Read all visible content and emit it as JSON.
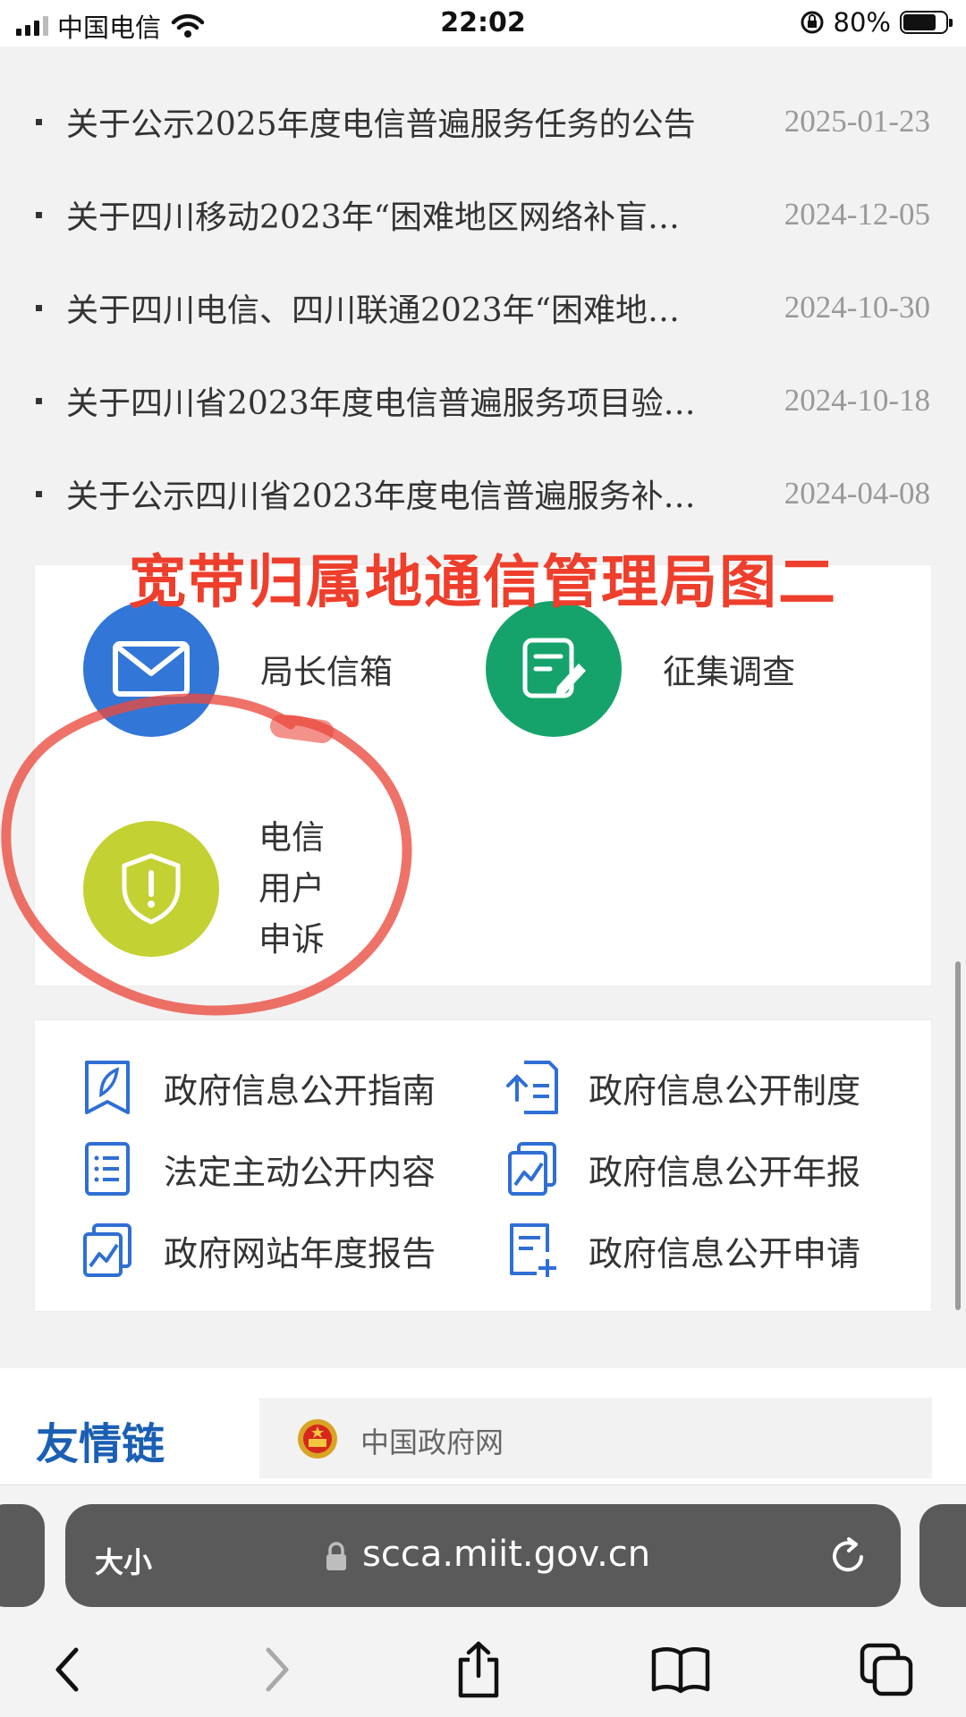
{
  "status_bar": {
    "carrier": "中国电信",
    "time": "22:02",
    "battery": "80%"
  },
  "news": [
    {
      "title": "关于公示2025年度电信普遍服务任务的公告",
      "date": "2025-01-23"
    },
    {
      "title": "关于四川移动2023年“困难地区网络补盲…",
      "date": "2024-12-05"
    },
    {
      "title": "关于四川电信、四川联通2023年“困难地…",
      "date": "2024-10-30"
    },
    {
      "title": "关于四川省2023年度电信普遍服务项目验…",
      "date": "2024-10-18"
    },
    {
      "title": "关于公示四川省2023年度电信普遍服务补…",
      "date": "2024-04-08"
    }
  ],
  "annotation": "宽带归属地通信管理局图二",
  "services": {
    "mailbox": "局长信箱",
    "survey": "征集调查",
    "complaint": "电信\n用户\n申诉",
    "complaint_lines": [
      "电信",
      "用户",
      "申诉"
    ]
  },
  "colors": {
    "mailbox": "#3277d8",
    "survey": "#16a36b",
    "complaint": "#c3d132",
    "annotation": "#ee3e2c",
    "link_icon": "#2f6fd4",
    "friend_title": "#1a5fb4"
  },
  "links": [
    {
      "label": "政府信息公开指南",
      "icon": "book-icon"
    },
    {
      "label": "政府信息公开制度",
      "icon": "document-upload-icon"
    },
    {
      "label": "法定主动公开内容",
      "icon": "list-document-icon"
    },
    {
      "label": "政府信息公开年报",
      "icon": "chart-report-icon"
    },
    {
      "label": "政府网站年度报告",
      "icon": "chart-report-icon"
    },
    {
      "label": "政府信息公开申请",
      "icon": "document-add-icon"
    }
  ],
  "friend_links": {
    "title": "友情链",
    "item": "中国政府网"
  },
  "browser": {
    "text_size_label": "大小",
    "url": "scca.miit.gov.cn"
  }
}
